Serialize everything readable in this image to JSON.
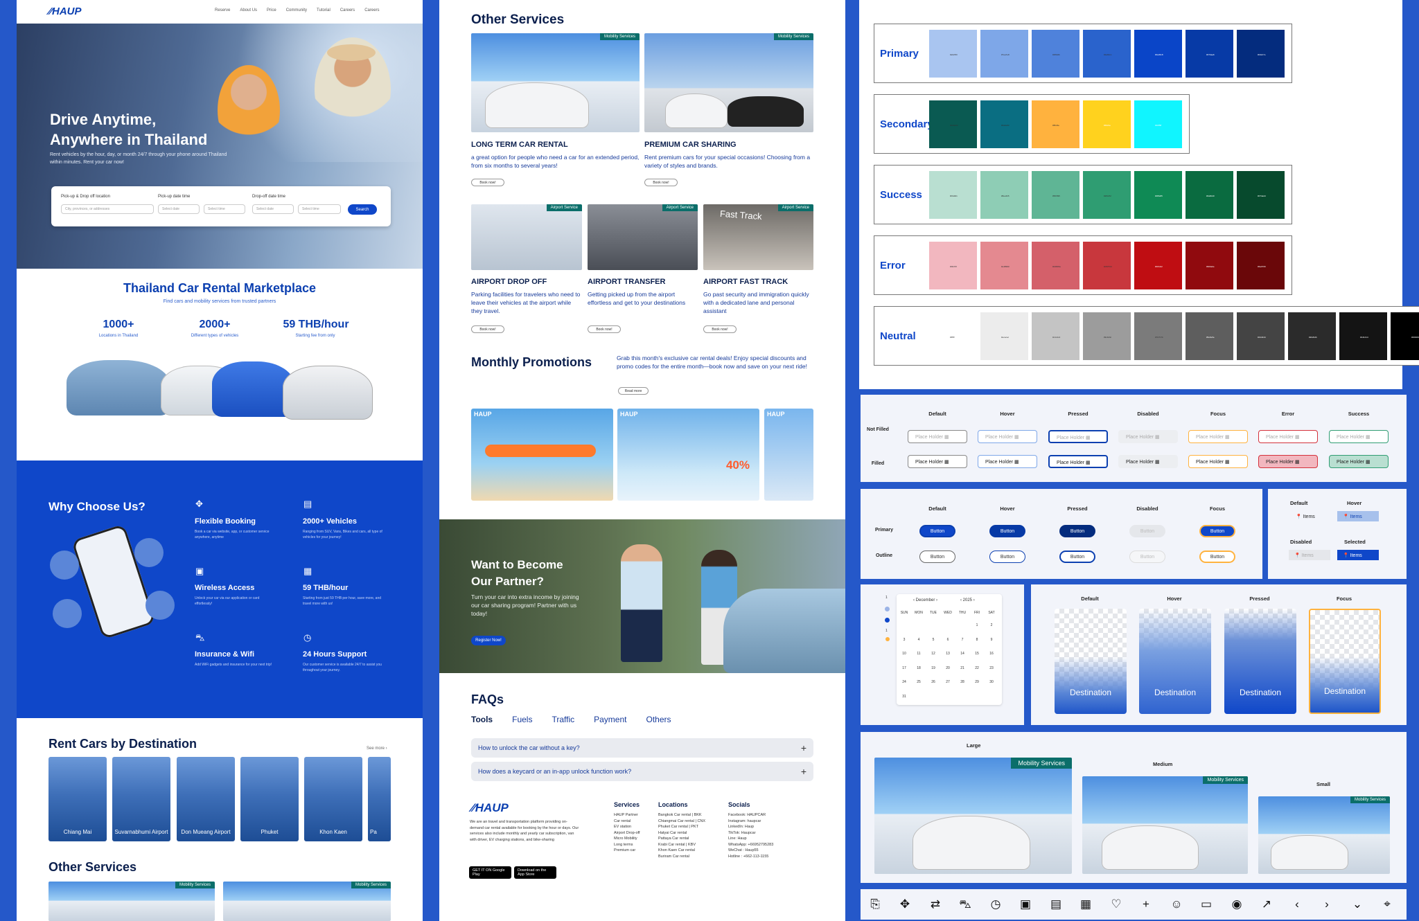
{
  "left": {
    "logo": "HAUP",
    "nav": [
      "Reserve",
      "About Us",
      "Price",
      "Community",
      "Tutorial",
      "Careers",
      "Careers"
    ],
    "hero": {
      "title_line1": "Drive Anytime,",
      "title_line2": "Anywhere in Thailand",
      "subtitle": "Rent vehicles by the hour, day, or month 24/7 through your phone around Thailand within minutes. Rent your car now!"
    },
    "search": {
      "lbl_location": "Pick-up & Drop off location",
      "lbl_pickup": "Pick-up date time",
      "lbl_dropoff": "Drop-off date time",
      "ph_location": "City, provinces, or addresses",
      "ph_date": "Select date",
      "ph_time": "Select time",
      "button": "Search"
    },
    "market": {
      "title": "Thailand Car Rental Marketplace",
      "subtitle": "Find cars and mobility services from trusted partners",
      "stats": [
        {
          "n": "1000+",
          "l": "Locations in Thailand"
        },
        {
          "n": "2000+",
          "l": "Different types of vehicles"
        },
        {
          "n": "59 THB/hour",
          "l": "Starting fee from only"
        }
      ]
    },
    "why": {
      "title": "Why Choose Us?",
      "features": [
        {
          "t": "Flexible Booking",
          "d": "Book a car via website, app, or customer service anywhere, anytime"
        },
        {
          "t": "2000+ Vehicles",
          "d": "Ranging from SUV, Vans, Bikes and cars, all type of vehicles for your journey!"
        },
        {
          "t": "Wireless Access",
          "d": "Unlock your car via our application or card effortlessly!"
        },
        {
          "t": "59 THB/hour",
          "d": "Starting from just 59 THB per hour, save more, and travel more with us!"
        },
        {
          "t": "Insurance & Wifi",
          "d": "Add WiFi gadgets and insurance for your next trip!"
        },
        {
          "t": "24 Hours Support",
          "d": "Our customer service is available 24/7 to assist you throughout your journey."
        }
      ]
    },
    "dest": {
      "title": "Rent Cars by Destination",
      "more": "See more ›",
      "items": [
        "Chiang Mai",
        "Suvarnabhumi Airport",
        "Don Mueang Airport",
        "Phuket",
        "Khon Kaen",
        "Pa"
      ]
    },
    "other_title": "Other Services",
    "tag": "Mobility Services"
  },
  "mid": {
    "title": "Other Services",
    "tag_mobility": "Mobility Services",
    "tag_airport": "Airport Service",
    "services": [
      {
        "t": "LONG TERM CAR RENTAL",
        "d": "a great option for people who need a car for an extended period, from six months to several years!"
      },
      {
        "t": "PREMIUM CAR SHARING",
        "d": "Rent premium cars for your special occasions! Choosing from a variety of styles and brands."
      },
      {
        "t": "AIRPORT DROP OFF",
        "d": "Parking facilities for travelers who need to leave their vehicles at the airport while they travel."
      },
      {
        "t": "AIRPORT TRANSFER",
        "d": "Getting picked up from the airport effortless and get to your destinations"
      },
      {
        "t": "AIRPORT FAST TRACK",
        "d": "Go past security and immigration quickly with a dedicated lane and personal assistant"
      }
    ],
    "fast_track_sign": "Fast Track",
    "book": "Book now!",
    "promo": {
      "title": "Monthly Promotions",
      "desc": "Grab this month's exclusive car rental deals! Enjoy special discounts and promo codes for the entire month—book now and save on your next ride!",
      "read": "Read more",
      "brand": "HAUP",
      "off": "40%"
    },
    "partner": {
      "title_line1": "Want to Become",
      "title_line2": "Our Partner?",
      "desc": "Turn your car into extra income by joining our car sharing program! Partner with us today!",
      "button": "Register Now!"
    },
    "faq": {
      "title": "FAQs",
      "tabs": [
        "Tools",
        "Fuels",
        "Traffic",
        "Payment",
        "Others"
      ],
      "q": [
        "How to unlock the car without a key?",
        "How does a keycard or an in-app unlock function work?"
      ]
    },
    "footer": {
      "logo": "HAUP",
      "about": "We are an travel and transportation platform providing on-demand car rental available for booking by the hour or days. Our services also include monthly and yearly car subscription, van with driver, EV charging stations, and bike-sharing",
      "gplay": "GET IT ON Google Play",
      "apple": "Download on the App Store",
      "services_h": "Services",
      "services": [
        "HAUP Partner",
        "Car rental",
        "EV station",
        "Airport Drop-off",
        "Micro Mobility",
        "Long terms",
        "Premium car"
      ],
      "loc_h": "Locations",
      "locations": [
        "Bangkok Car rental | BKK",
        "Chiangmai Car rental | CNX",
        "Phuket Car rental | PKT",
        "Hatyai Car rental",
        "Pattaya Car rental",
        "Krabi Car rental | KBV",
        "Khon Kaen Car rental",
        "Buriram Car rental"
      ],
      "soc_h": "Socials",
      "socials": [
        "Facebook: HAUPCAR",
        "Instagram: haupcar",
        "LinkedIn: Haup",
        "TikTok: Haupcar",
        "Line: Haup",
        "WhatsApp: +66952795283",
        "WeChat : Haup55",
        "Hotline : +662-113-1155"
      ]
    }
  },
  "right": {
    "palettes": [
      {
        "name": "Primary",
        "colors": [
          "#a9c5f0",
          "#7ea7e8",
          "#4f82db",
          "#2a63cc",
          "#0a45c8",
          "#073aa6",
          "#042c7e"
        ]
      },
      {
        "name": "Secondary",
        "colors": [
          "#0a5a52",
          "#0a6e82",
          "#ffb23e",
          "#ffd21e",
          "#10f5ff"
        ]
      },
      {
        "name": "Success",
        "colors": [
          "#b9dfd1",
          "#8ecdb5",
          "#5fb595",
          "#2f9d72",
          "#0f8a55",
          "#0a6b40",
          "#074a2d"
        ]
      },
      {
        "name": "Error",
        "colors": [
          "#f2b7bf",
          "#e48990",
          "#d4606a",
          "#c8373d",
          "#bf0d12",
          "#900a0e",
          "#6a0709"
        ]
      },
      {
        "name": "Neutral",
        "colors": [
          "#ffffff",
          "#ececec",
          "#c4c4c4",
          "#9c9c9c",
          "#7b7b7b",
          "#5e5e5e",
          "#444444",
          "#2b2b2b",
          "#141414",
          "#000000"
        ]
      }
    ],
    "input_states": {
      "headers": [
        "Default",
        "Hover",
        "Pressed",
        "Disabled",
        "Focus",
        "Error",
        "Success"
      ],
      "rows": [
        "Not Filled",
        "Filled"
      ],
      "placeholder": "Place Holder"
    },
    "button_states": {
      "headers": [
        "Default",
        "Hover",
        "Pressed",
        "Disabled",
        "Focus"
      ],
      "rows": [
        "Primary",
        "Outline"
      ],
      "label": "Button"
    },
    "menu_states": {
      "default": "Default",
      "hover": "Hover",
      "disabled": "Disabled",
      "selected": "Selected",
      "item": "Items"
    },
    "calendar": {
      "month": "December",
      "year": "2025",
      "days": [
        "SUN",
        "MON",
        "TUE",
        "WED",
        "THU",
        "FRI",
        "SAT"
      ],
      "dates": [
        "",
        "",
        "",
        "",
        "",
        "1",
        "2",
        "3",
        "4",
        "5",
        "6",
        "7",
        "8",
        "9",
        "10",
        "11",
        "12",
        "13",
        "14",
        "15",
        "16",
        "17",
        "18",
        "19",
        "20",
        "21",
        "22",
        "23",
        "24",
        "25",
        "26",
        "27",
        "28",
        "29",
        "30",
        "31"
      ]
    },
    "dest_states": {
      "headers": [
        "Default",
        "Hover",
        "Pressed",
        "Focus"
      ],
      "label": "Destination"
    },
    "sizes": {
      "large": "Large",
      "medium": "Medium",
      "small": "Small",
      "tag": "Mobility Services"
    }
  }
}
